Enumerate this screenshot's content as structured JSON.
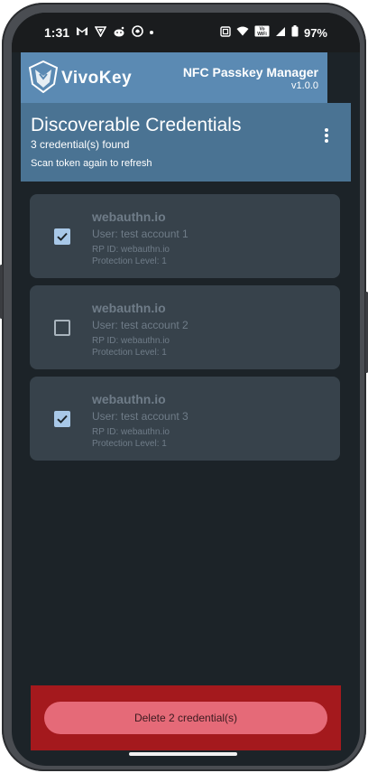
{
  "status_bar": {
    "time": "1:31",
    "battery_percent": "97%",
    "wifi_badge": "Vo WiFi",
    "left_icons": [
      "gmail-icon",
      "vpn-icon",
      "reddit-icon",
      "firefox-icon",
      "dot-icon"
    ],
    "right_icons": [
      "nfc-icon",
      "wifi-icon",
      "vowifi-icon",
      "signal-icon",
      "battery-icon"
    ]
  },
  "app_header": {
    "logo_text": "VivoKey",
    "title": "NFC Passkey Manager",
    "version": "v1.0.0"
  },
  "section": {
    "title": "Discoverable Credentials",
    "count_text": "3 credential(s) found",
    "hint": "Scan token again to refresh",
    "menu_icon": "more-vert-icon"
  },
  "credentials": [
    {
      "rp": "webauthn.io",
      "user": "User: test account 1",
      "rp_id": "RP ID: webauthn.io",
      "protection": "Protection Level: 1",
      "checked": true
    },
    {
      "rp": "webauthn.io",
      "user": "User: test account 2",
      "rp_id": "RP ID: webauthn.io",
      "protection": "Protection Level: 1",
      "checked": false
    },
    {
      "rp": "webauthn.io",
      "user": "User: test account 3",
      "rp_id": "RP ID: webauthn.io",
      "protection": "Protection Level: 1",
      "checked": true
    }
  ],
  "delete_button": {
    "label": "Delete 2 credential(s)"
  },
  "colors": {
    "header_bg": "#5b8ab3",
    "banner_bg": "#4a7393",
    "screen_bg": "#1c2328",
    "card_bg": "#37424b",
    "checkbox_checked": "#a8c8e8",
    "delete_bar_bg": "#a4191d",
    "delete_button_bg": "#e56a78"
  }
}
